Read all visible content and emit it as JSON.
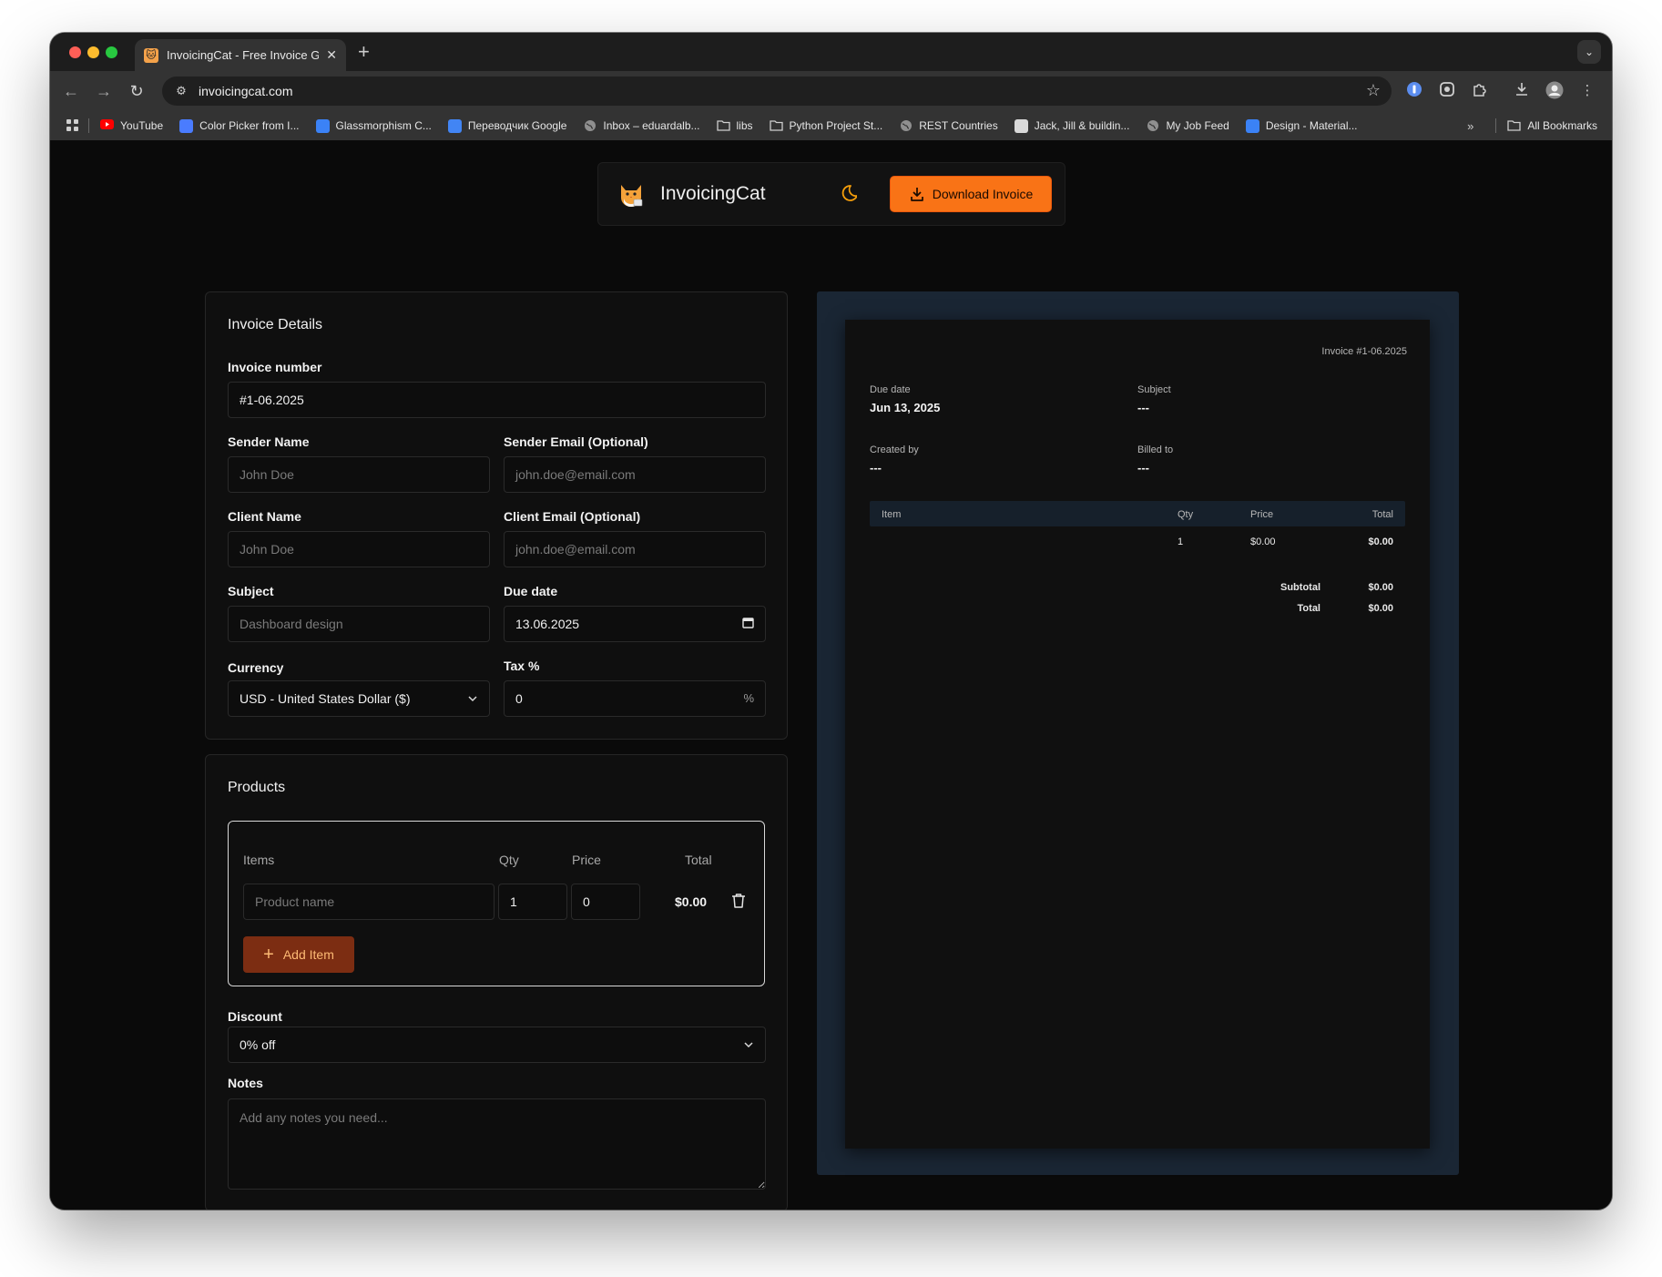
{
  "browser": {
    "tab_title": "InvoicingCat - Free Invoice Generator",
    "url": "invoicingcat.com",
    "bookmarks": [
      {
        "label": "YouTube",
        "icon": "youtube-icon",
        "color": "#ff0000"
      },
      {
        "label": "Color Picker from I...",
        "icon": "color-picker-icon",
        "color": "#4a7cff"
      },
      {
        "label": "Glassmorphism C...",
        "icon": "glassmorphism-icon",
        "color": "#3b82f6"
      },
      {
        "label": "Переводчик Google",
        "icon": "google-translate-icon",
        "color": "#4285f4"
      },
      {
        "label": "Inbox – eduardalb...",
        "icon": "globe-icon",
        "color": "#9a9a9a"
      },
      {
        "label": "libs",
        "icon": "folder-icon",
        "color": "#cfcfcf"
      },
      {
        "label": "Python Project St...",
        "icon": "folder-icon",
        "color": "#cfcfcf"
      },
      {
        "label": "REST Countries",
        "icon": "globe-icon",
        "color": "#9a9a9a"
      },
      {
        "label": "Jack, Jill & buildin...",
        "icon": "jack-jill-icon",
        "color": "#d9d9d9"
      },
      {
        "label": "My Job Feed",
        "icon": "globe-icon",
        "color": "#9a9a9a"
      },
      {
        "label": "Design - Material...",
        "icon": "material-design-icon",
        "color": "#3b82f6"
      }
    ],
    "all_bookmarks": "All Bookmarks"
  },
  "app": {
    "brand": "InvoicingCat",
    "download_label": "Download Invoice",
    "accent": "#f97316"
  },
  "details": {
    "title": "Invoice Details",
    "invoice_number_label": "Invoice number",
    "invoice_number": "#1-06.2025",
    "sender_name_label": "Sender Name",
    "sender_name_placeholder": "John Doe",
    "sender_email_label": "Sender Email (Optional)",
    "sender_email_placeholder": "john.doe@email.com",
    "client_name_label": "Client Name",
    "client_name_placeholder": "John Doe",
    "client_email_label": "Client Email (Optional)",
    "client_email_placeholder": "john.doe@email.com",
    "subject_label": "Subject",
    "subject_placeholder": "Dashboard design",
    "due_date_label": "Due date",
    "due_date": "13.06.2025",
    "currency_label": "Currency",
    "currency": "USD - United States Dollar ($)",
    "tax_label": "Tax %",
    "tax": "0",
    "tax_suffix": "%"
  },
  "products": {
    "title": "Products",
    "col_items": "Items",
    "col_qty": "Qty",
    "col_price": "Price",
    "col_total": "Total",
    "product_placeholder": "Product name",
    "qty": "1",
    "price": "0",
    "line_total": "$0.00",
    "add_item_label": "Add Item",
    "discount_label": "Discount",
    "discount": "0% off",
    "notes_label": "Notes",
    "notes_placeholder": "Add any notes you need..."
  },
  "preview": {
    "invoice_ref": "Invoice #1-06.2025",
    "due_date_label": "Due date",
    "due_date": "Jun 13, 2025",
    "subject_label": "Subject",
    "subject": "---",
    "created_by_label": "Created by",
    "created_by": "---",
    "billed_to_label": "Billed to",
    "billed_to": "---",
    "th_item": "Item",
    "th_qty": "Qty",
    "th_price": "Price",
    "th_total": "Total",
    "row_qty": "1",
    "row_price": "$0.00",
    "row_total": "$0.00",
    "subtotal_label": "Subtotal",
    "subtotal": "$0.00",
    "total_label": "Total",
    "total": "$0.00"
  }
}
